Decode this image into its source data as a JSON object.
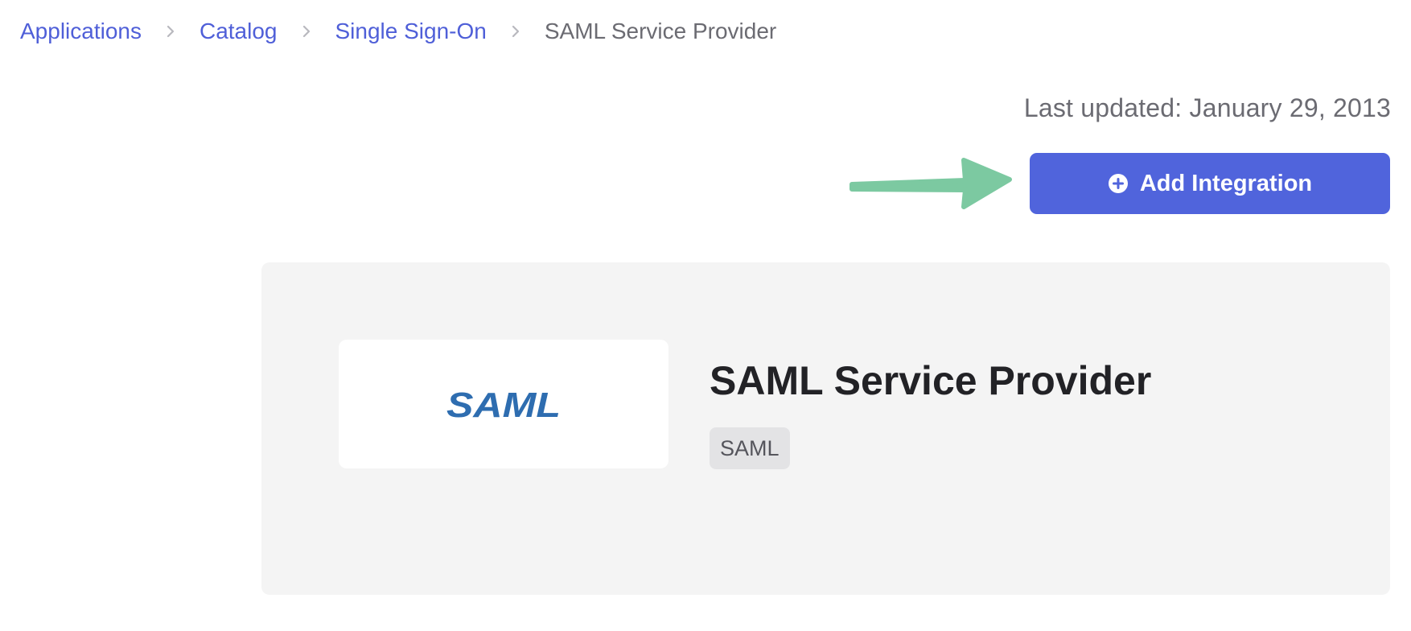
{
  "breadcrumb": {
    "items": [
      {
        "label": "Applications"
      },
      {
        "label": "Catalog"
      },
      {
        "label": "Single Sign-On"
      }
    ],
    "current": "SAML Service Provider"
  },
  "header": {
    "last_updated_label": "Last updated:",
    "last_updated_date": "January 29, 2013"
  },
  "actions": {
    "add_integration_label": "Add Integration"
  },
  "integration": {
    "logo_text": "SAML",
    "title": "SAML Service Provider",
    "tag": "SAML"
  },
  "colors": {
    "link": "#4f5fd8",
    "button": "#5064dc",
    "annotation_arrow": "#7cc9a1",
    "logo": "#2e6db0"
  }
}
